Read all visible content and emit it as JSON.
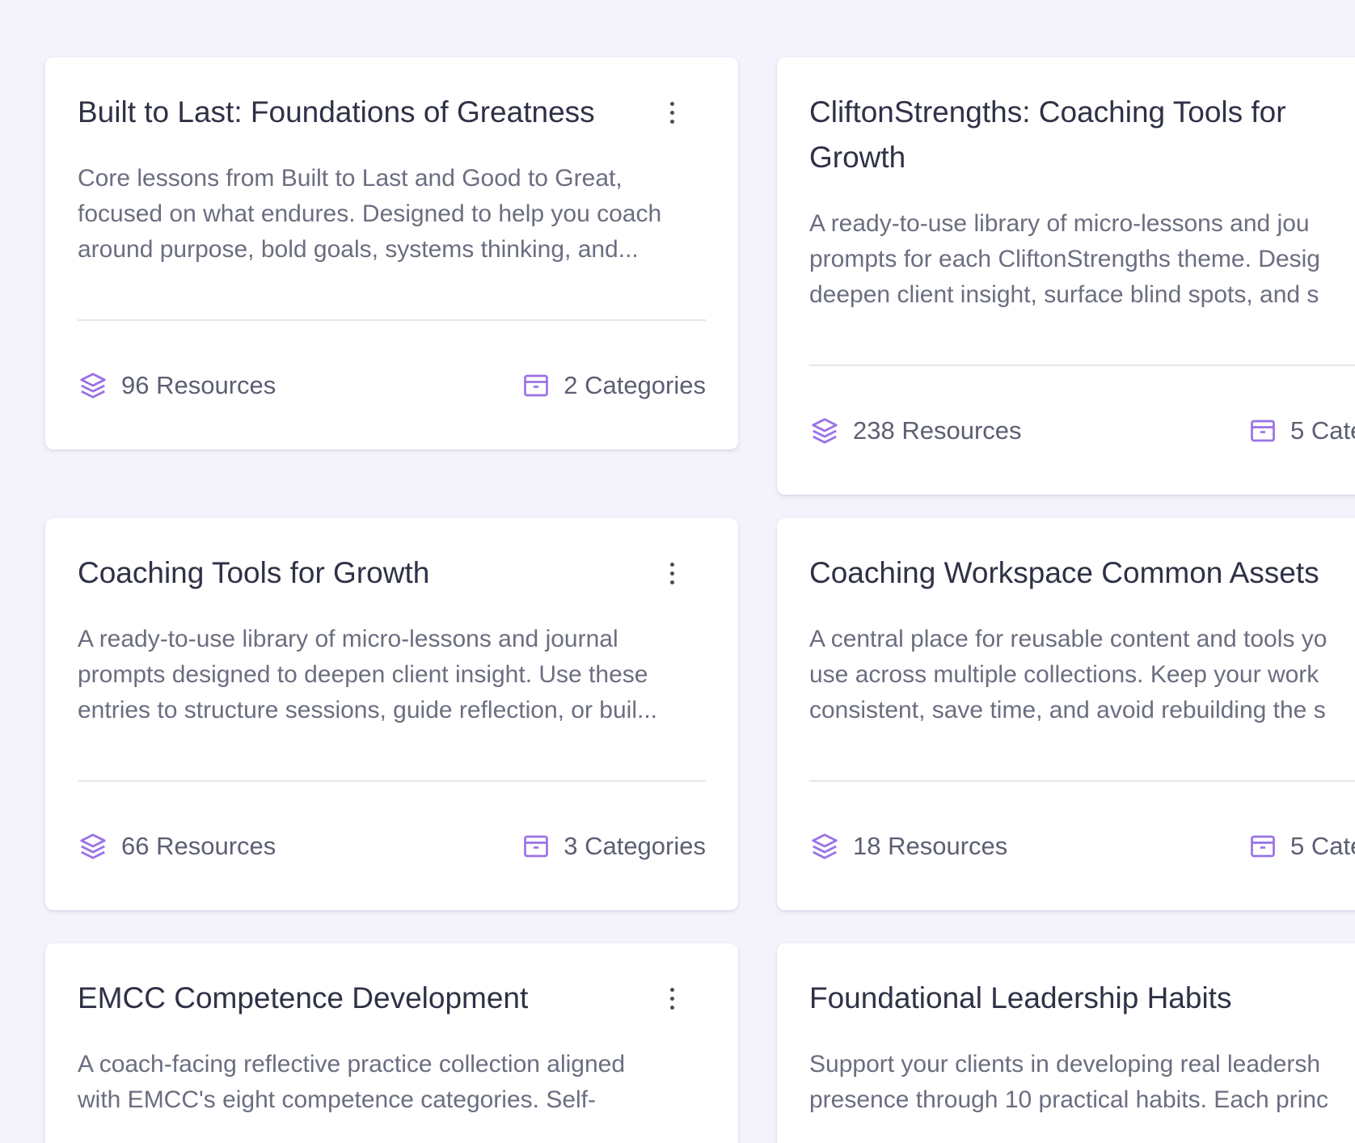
{
  "colors": {
    "background": "#f4f3fc",
    "card": "#ffffff",
    "title": "#2f3146",
    "description": "#6b6e80",
    "meta_text": "#5c5f72",
    "icon_accent": "#9a72e6",
    "divider": "#e6e6ee"
  },
  "cards": [
    {
      "title": "Built to Last: Foundations of Greatness",
      "description_lines": [
        "Core lessons from Built to Last and Good to Great,",
        "focused on what endures. Designed to help you coach",
        "around purpose, bold goals, systems thinking, and..."
      ],
      "resources": "96 Resources",
      "categories": "2 Categories",
      "resources_icon": "stack-layers-icon",
      "categories_icon": "archive-box-icon",
      "menu_icon": "more-vertical-icon"
    },
    {
      "title": "CliftonStrengths: Coaching Tools for Growth",
      "description_lines": [
        "A ready-to-use library of micro-lessons and jou",
        "prompts for each CliftonStrengths theme. Desig",
        "deepen client insight, surface blind spots, and s"
      ],
      "resources": "238 Resources",
      "categories": "5 Cate",
      "resources_icon": "stack-layers-icon",
      "categories_icon": "archive-box-icon"
    },
    {
      "title": "Coaching Tools for Growth",
      "description_lines": [
        "A ready-to-use library of micro-lessons and journal",
        "prompts designed to deepen client insight. Use these",
        "entries to structure sessions, guide reflection, or buil..."
      ],
      "resources": "66 Resources",
      "categories": "3 Categories",
      "resources_icon": "stack-layers-icon",
      "categories_icon": "archive-box-icon",
      "menu_icon": "more-vertical-icon"
    },
    {
      "title": "Coaching Workspace Common Assets",
      "description_lines": [
        "A central place for reusable content and tools yo",
        "use across multiple collections. Keep your work",
        "consistent, save time, and avoid rebuilding the s"
      ],
      "resources": "18 Resources",
      "categories": "5 Cate",
      "resources_icon": "stack-layers-icon",
      "categories_icon": "archive-box-icon"
    },
    {
      "title": "EMCC Competence Development",
      "description_lines": [
        "A coach-facing reflective practice collection aligned",
        "with EMCC's eight competence categories. Self-"
      ],
      "menu_icon": "more-vertical-icon"
    },
    {
      "title": "Foundational Leadership Habits",
      "description_lines": [
        "Support your clients in developing real leadersh",
        "presence through 10 practical habits. Each princ"
      ]
    }
  ]
}
